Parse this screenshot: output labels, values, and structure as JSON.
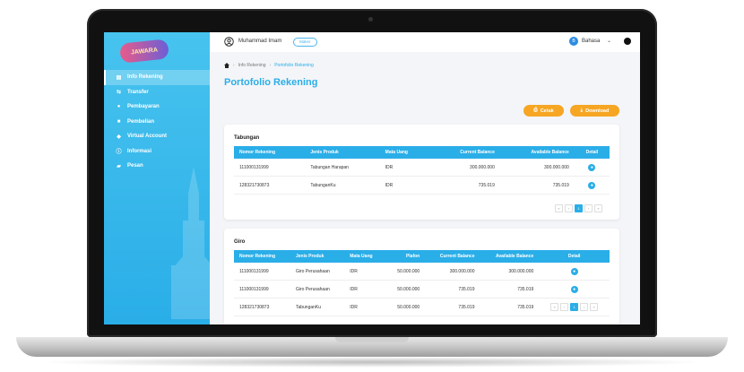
{
  "app": {
    "logo_text": "JAWARA"
  },
  "sidebar": {
    "items": [
      {
        "label": "Info Rekening",
        "icon": "list-icon",
        "active": true
      },
      {
        "label": "Transfer",
        "icon": "transfer-icon"
      },
      {
        "label": "Pembayaran",
        "icon": "payment-icon"
      },
      {
        "label": "Pembelian",
        "icon": "purchase-icon"
      },
      {
        "label": "Virtual Account",
        "icon": "virtual-account-icon"
      },
      {
        "label": "Informasi",
        "icon": "info-icon"
      },
      {
        "label": "Pesan",
        "icon": "message-icon"
      }
    ]
  },
  "topbar": {
    "user_name": "Muhammad Imam",
    "role_badge": "Maker",
    "language": "Bahasa",
    "language_icon_letter": "B"
  },
  "breadcrumb": {
    "parent": "Info Rekening",
    "current": "Portofolio Rekening"
  },
  "page": {
    "title": "Portofolio Rekening"
  },
  "actions": {
    "cetak_label": "Cetak",
    "download_label": "Download"
  },
  "tabungan": {
    "title": "Tabungan",
    "columns": [
      "Nomor Rekening",
      "Jenis Produk",
      "Mata Uang",
      "Current Balance",
      "Available Balance",
      "Detail"
    ],
    "rows": [
      {
        "nomor": "111000131999",
        "jenis": "Tabungan Harapan",
        "mata_uang": "IDR",
        "current": "300.000.000",
        "available": "300.000.000"
      },
      {
        "nomor": "128321730873",
        "jenis": "TabunganKu",
        "mata_uang": "IDR",
        "current": "735.019",
        "available": "735.019"
      }
    ],
    "pager": [
      "«",
      "‹",
      "1",
      "›",
      "»"
    ]
  },
  "giro": {
    "title": "Giro",
    "columns": [
      "Nomor Rekening",
      "Jenis Produk",
      "Mata Uang",
      "Plafon",
      "Current Balance",
      "Available Balance",
      "Detail"
    ],
    "rows": [
      {
        "nomor": "111000131999",
        "jenis": "Giro Perusahaan",
        "mata_uang": "IDR",
        "plafon": "50.000.000",
        "current": "300.000.000",
        "available": "300.000.000"
      },
      {
        "nomor": "111000131999",
        "jenis": "Giro Perusahaan",
        "mata_uang": "IDR",
        "plafon": "50.000.000",
        "current": "735.019",
        "available": "735.019"
      },
      {
        "nomor": "128321730873",
        "jenis": "TabunganKu",
        "mata_uang": "IDR",
        "plafon": "50.000.000",
        "current": "735.019",
        "available": "735.019"
      }
    ],
    "pager": [
      "«",
      "‹",
      "1",
      "›",
      "»"
    ]
  },
  "colors": {
    "accent": "#2aaee8",
    "button": "#f6a623",
    "power": "#e0302a"
  }
}
